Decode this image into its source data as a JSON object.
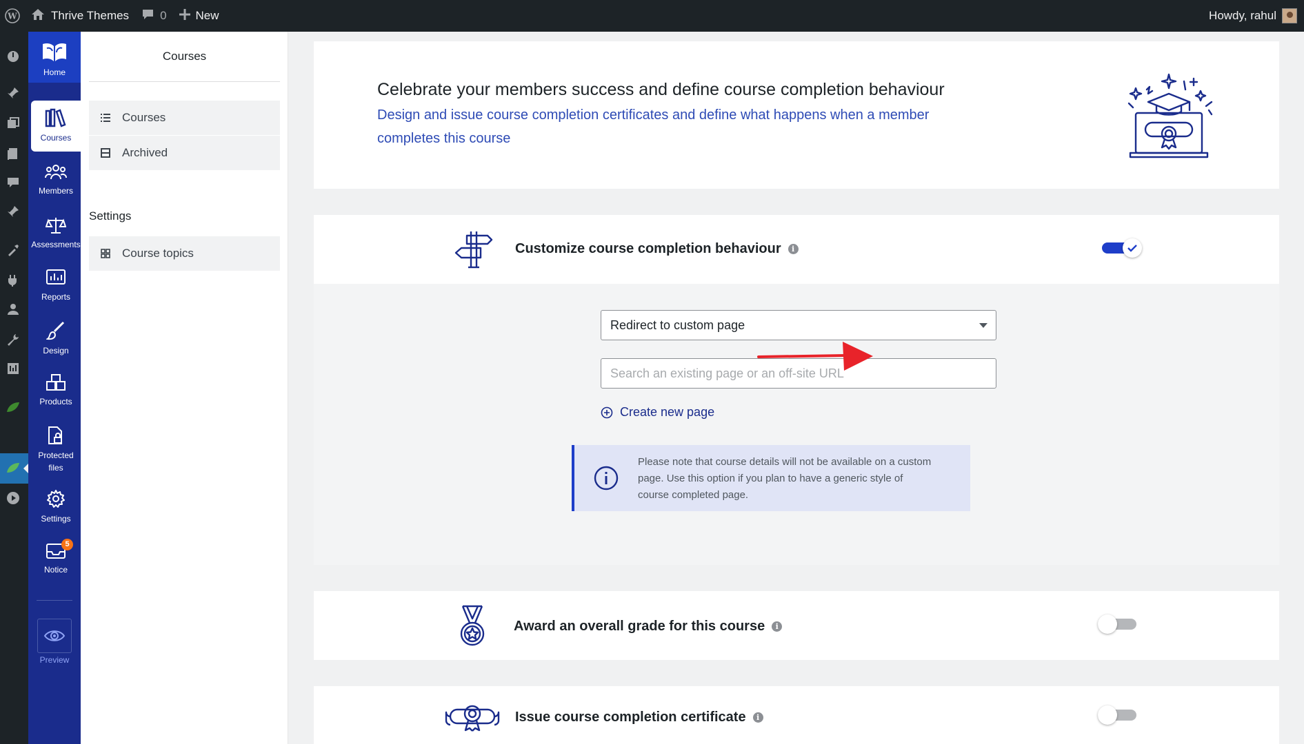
{
  "adminbar": {
    "site_name": "Thrive Themes",
    "comments_count": "0",
    "new_label": "New",
    "howdy": "Howdy, rahul"
  },
  "thrive_nav": {
    "home": "Home",
    "courses": "Courses",
    "members": "Members",
    "assessments": "Assessments",
    "reports": "Reports",
    "design": "Design",
    "products": "Products",
    "protected_files_line1": "Protected",
    "protected_files_line2": "files",
    "settings": "Settings",
    "notice": "Notice",
    "notice_badge": "5",
    "preview": "Preview"
  },
  "subnav": {
    "title": "Courses",
    "items": [
      {
        "label": "Courses",
        "icon": "list-icon"
      },
      {
        "label": "Archived",
        "icon": "archive-icon"
      }
    ],
    "settings_heading": "Settings",
    "settings_items": [
      {
        "label": "Course topics",
        "icon": "grid-icon"
      }
    ]
  },
  "hero": {
    "title": "Celebrate your members success and define course completion behaviour",
    "subtitle": "Design and issue course completion certificates and define what happens when a member completes this course"
  },
  "completion": {
    "title": "Customize course completion behaviour",
    "enabled": true,
    "selected_option": "Redirect to custom page",
    "search_placeholder": "Search an existing page or an off-site URL",
    "create_label": "Create new page",
    "notice_text": "Please note that course details will not be available on a custom page. Use this option if you plan to have a generic style of course completed page."
  },
  "grade": {
    "title": "Award an overall grade for this course",
    "enabled": false
  },
  "certificate": {
    "title": "Issue course completion certificate",
    "enabled": false
  },
  "colors": {
    "thrive_nav": "#1a2c8c",
    "accent_blue": "#1e3ec9",
    "arrow_red": "#e8232a",
    "wp_bar": "#1d2327"
  }
}
